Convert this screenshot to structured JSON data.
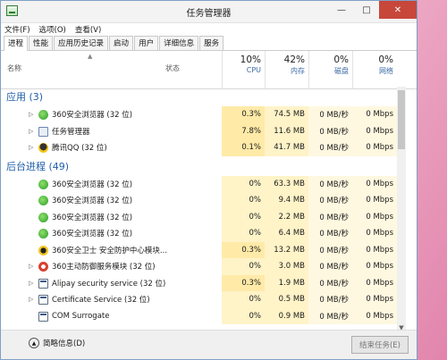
{
  "window": {
    "title": "任务管理器",
    "min": "—",
    "max": "□",
    "close": "✕"
  },
  "menu": [
    "文件(F)",
    "选项(O)",
    "查看(V)"
  ],
  "tabs": [
    "进程",
    "性能",
    "应用历史记录",
    "启动",
    "用户",
    "详细信息",
    "服务"
  ],
  "columns": {
    "name": "名称",
    "status": "状态",
    "cpu": {
      "pct": "10%",
      "label": "CPU"
    },
    "mem": {
      "pct": "42%",
      "label": "内存"
    },
    "disk": {
      "pct": "0%",
      "label": "磁盘"
    },
    "net": {
      "pct": "0%",
      "label": "网络"
    }
  },
  "groups": {
    "apps": "应用 (3)",
    "background": "后台进程 (49)"
  },
  "app_rows": [
    {
      "name": "360安全浏览器 (32 位)",
      "icon": "browser-360-icon",
      "cpu": "0.3%",
      "mem": "74.5 MB",
      "disk": "0 MB/秒",
      "net": "0 Mbps"
    },
    {
      "name": "任务管理器",
      "icon": "task-manager-icon",
      "cpu": "7.8%",
      "mem": "11.6 MB",
      "disk": "0 MB/秒",
      "net": "0 Mbps"
    },
    {
      "name": "腾讯QQ (32 位)",
      "icon": "qq-icon",
      "cpu": "0.1%",
      "mem": "41.7 MB",
      "disk": "0 MB/秒",
      "net": "0 Mbps"
    }
  ],
  "bg_rows": [
    {
      "name": "360安全浏览器 (32 位)",
      "icon": "browser-360-icon",
      "cpu": "0%",
      "mem": "63.3 MB",
      "disk": "0 MB/秒",
      "net": "0 Mbps",
      "expand": false
    },
    {
      "name": "360安全浏览器 (32 位)",
      "icon": "browser-360-icon",
      "cpu": "0%",
      "mem": "9.4 MB",
      "disk": "0 MB/秒",
      "net": "0 Mbps",
      "expand": false
    },
    {
      "name": "360安全浏览器 (32 位)",
      "icon": "browser-360-icon",
      "cpu": "0%",
      "mem": "2.2 MB",
      "disk": "0 MB/秒",
      "net": "0 Mbps",
      "expand": false
    },
    {
      "name": "360安全浏览器 (32 位)",
      "icon": "browser-360-icon",
      "cpu": "0%",
      "mem": "6.4 MB",
      "disk": "0 MB/秒",
      "net": "0 Mbps",
      "expand": false
    },
    {
      "name": "360安全卫士 安全防护中心模块...",
      "icon": "360-guard-icon",
      "cpu": "0.3%",
      "mem": "13.2 MB",
      "disk": "0 MB/秒",
      "net": "0 Mbps",
      "expand": false
    },
    {
      "name": "360主动防御服务模块 (32 位)",
      "icon": "360-service-icon",
      "cpu": "0%",
      "mem": "3.0 MB",
      "disk": "0 MB/秒",
      "net": "0 Mbps",
      "expand": true
    },
    {
      "name": "Alipay security service (32 位)",
      "icon": "service-icon",
      "cpu": "0.3%",
      "mem": "1.9 MB",
      "disk": "0 MB/秒",
      "net": "0 Mbps",
      "expand": true
    },
    {
      "name": "Certificate Service (32 位)",
      "icon": "service-icon",
      "cpu": "0%",
      "mem": "0.5 MB",
      "disk": "0 MB/秒",
      "net": "0 Mbps",
      "expand": true
    },
    {
      "name": "COM Surrogate",
      "icon": "service-icon",
      "cpu": "0%",
      "mem": "0.9 MB",
      "disk": "0 MB/秒",
      "net": "0 Mbps",
      "expand": false
    }
  ],
  "footer": {
    "fewer": "简略信息(D)",
    "end_task": "结束任务(E)"
  }
}
